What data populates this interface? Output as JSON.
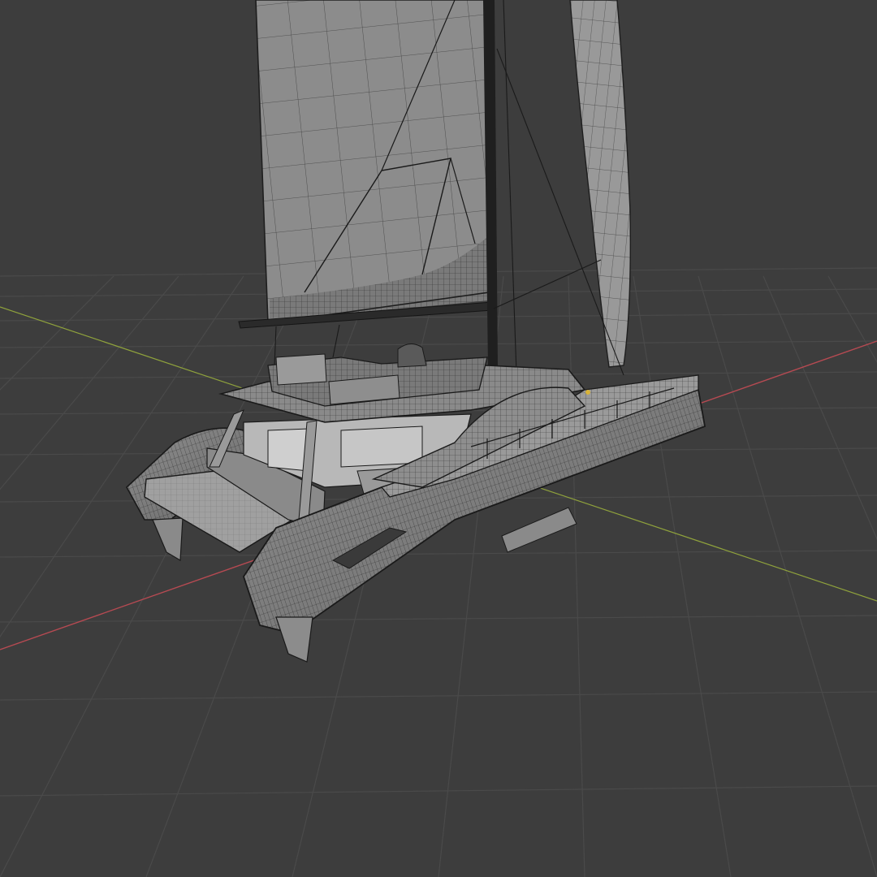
{
  "viewport": {
    "background": "#3d3d3d",
    "grid_color": "#4a4a4a",
    "x_axis_color": "#b64a52",
    "y_axis_color": "#8fa23c"
  },
  "model": {
    "wire_color": "#1a1a1a",
    "shade_light": "#9b9b9b",
    "shade_mid": "#7d7d7d",
    "shade_dark": "#5f5f5f",
    "accent_marker": "#d8b33a"
  }
}
